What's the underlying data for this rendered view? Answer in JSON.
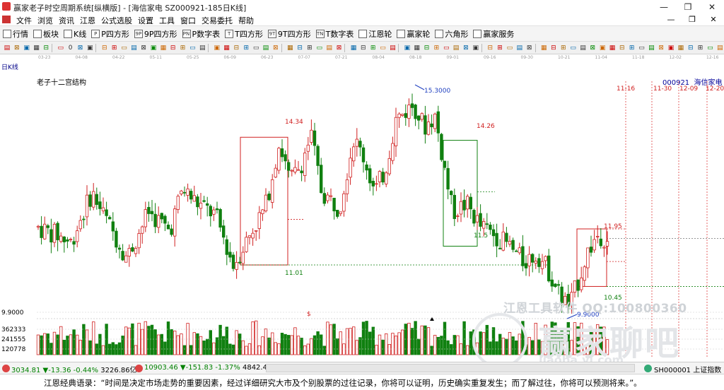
{
  "window": {
    "title": "赢家老子时空周期系统[纵横版] - [海信家电  SZ000921-185日K线]",
    "minimize": "—",
    "maximize": "❐",
    "close": "✕"
  },
  "menu": {
    "items": [
      "文件",
      "浏览",
      "资讯",
      "江恩",
      "公式选股",
      "设置",
      "工具",
      "窗口",
      "交易委托",
      "帮助"
    ],
    "mdi_min": "—",
    "mdi_max": "❐",
    "mdi_close": "✕"
  },
  "toolbar": {
    "items": [
      {
        "label": "行情",
        "icon": "grid-icon"
      },
      {
        "label": "板块",
        "icon": "blocks-icon"
      },
      {
        "label": "K线",
        "icon": "kline-icon"
      },
      {
        "label": "P四方形",
        "icon": "p-square-icon",
        "tag": "P"
      },
      {
        "label": "9P四方形",
        "icon": "9p-square-icon",
        "tag": "9P"
      },
      {
        "label": "P数字表",
        "icon": "p-number-icon",
        "tag": "PN"
      },
      {
        "label": "T四方形",
        "icon": "t-square-icon",
        "tag": "T"
      },
      {
        "label": "9T四方形",
        "icon": "9t-square-icon",
        "tag": "9T"
      },
      {
        "label": "T数字表",
        "icon": "t-number-icon",
        "tag": "TN"
      },
      {
        "label": "江恩轮",
        "icon": "gann-wheel-icon"
      },
      {
        "label": "赢家轮",
        "icon": "winner-wheel-icon"
      },
      {
        "label": "六角形",
        "icon": "hexagon-icon"
      },
      {
        "label": "赢家服务",
        "icon": "service-icon"
      }
    ]
  },
  "drawtools": {
    "count_label": "0"
  },
  "chart": {
    "period_label": "日K线",
    "structure_label": "老子十二宫结构",
    "stock_code": "000921",
    "stock_name": "海信家电",
    "date_ticks": [
      "03-23",
      "04-08",
      "04-22",
      "05-11",
      "05-25",
      "06-09",
      "06-23",
      "07-07",
      "07-21",
      "08-04",
      "08-18",
      "09-01",
      "09-16",
      "09-30",
      "10-21",
      "11-04",
      "11-18",
      "12-02",
      "12-16"
    ],
    "future_dates": [
      "11-16",
      "11-30",
      "12-09",
      "12-20"
    ],
    "annotations": {
      "high": "15.3000",
      "box1_top": "14.34",
      "box1_bottom": "11.01",
      "box2_top": "14.26",
      "box2_bottom": "11.5",
      "box3_top": "11.95",
      "box3_bottom": "10.45",
      "low": "9.9000",
      "vol_marker": "$"
    },
    "volume_axis": [
      "9.9000",
      "362333",
      "241555",
      "120778"
    ],
    "colors": {
      "up": "#d02020",
      "down": "#108010",
      "box": "#d02020",
      "box_green": "#108010",
      "axis": "#999999"
    }
  },
  "chart_data": {
    "type": "candlestick",
    "ylim": [
      9.5,
      15.8
    ],
    "candles": []
  },
  "watermark": {
    "line1": "江恩工具软件 QQ:100800360",
    "line2": "赢家聊吧",
    "line3": "liaoba.yj.com"
  },
  "status": {
    "sh_index": "3034.81",
    "sh_change": "▼-13.36",
    "sh_pct": "-0.44%",
    "sh_amount": "3226.86亿",
    "sz_index": "10903.46",
    "sz_change": "▼-151.83",
    "sz_pct": "-1.37%",
    "sz_amount": "4842.4",
    "right_label": "SH000001 上证指数"
  },
  "quote": {
    "text": "江恩经典语录：“时间是决定市场走势的重要因素，经过详细研究大市及个别股票的过往记录，你将可以证明，历史确实重复发生；而了解过往，你将可以预测将来。”。"
  }
}
